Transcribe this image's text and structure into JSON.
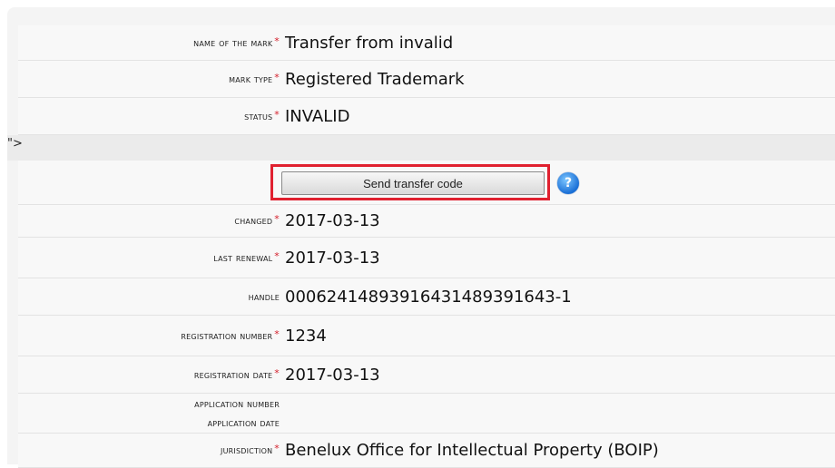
{
  "fields_top": [
    {
      "label": "Name of the mark",
      "required": true,
      "value": "Transfer from invalid"
    },
    {
      "label": "Mark type",
      "required": true,
      "value": "Registered Trademark"
    },
    {
      "label": "Status",
      "required": true,
      "value": "INVALID"
    }
  ],
  "stray_text": "\">",
  "send_transfer_button": "Send transfer code",
  "help_icon_glyph": "?",
  "required_marker": "*",
  "fields_bottom": [
    {
      "label": "Changed",
      "required": true,
      "value": "2017-03-13"
    },
    {
      "label": "Last renewal",
      "required": true,
      "value": "2017-03-13"
    },
    {
      "label": "Handle",
      "required": false,
      "value": "000624148939164314893916​43-1"
    },
    {
      "label": "Registration number",
      "required": true,
      "value": "1234"
    },
    {
      "label": "Registration date",
      "required": true,
      "value": "2017-03-13"
    },
    {
      "label": "Application number",
      "required": false,
      "value": ""
    },
    {
      "label": "Application date",
      "required": false,
      "value": ""
    },
    {
      "label": "Jurisdiction",
      "required": true,
      "value": "Benelux Office for Intellectual Property (BOIP)"
    }
  ],
  "colors": {
    "required_star": "#d51f2b",
    "highlight_box": "#e0202f",
    "help_icon": "#1a6fd6"
  }
}
